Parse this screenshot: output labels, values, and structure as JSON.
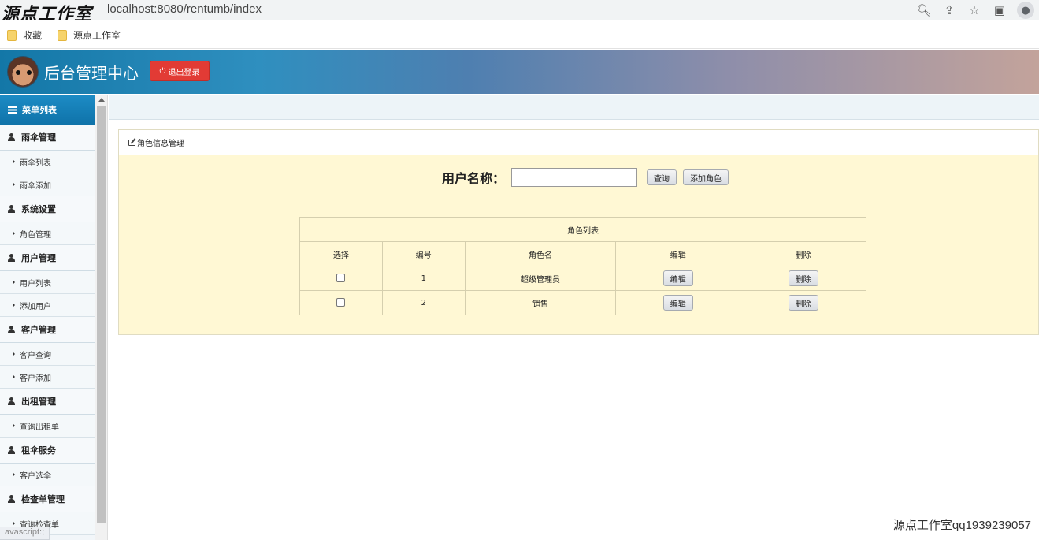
{
  "browser": {
    "url": "localhost:8080/rentumb/index",
    "watermark_top": "源点工作室",
    "bookmarks": [
      "收藏",
      "源点工作室"
    ],
    "status_text": "avascript:;"
  },
  "header": {
    "title": "后台管理中心",
    "logout_label": "退出登录"
  },
  "sidebar": {
    "title": "菜单列表",
    "groups": [
      {
        "label": "雨伞管理",
        "items": [
          "雨伞列表",
          "雨伞添加"
        ]
      },
      {
        "label": "系统设置",
        "items": [
          "角色管理"
        ]
      },
      {
        "label": "用户管理",
        "items": [
          "用户列表",
          "添加用户"
        ]
      },
      {
        "label": "客户管理",
        "items": [
          "客户查询",
          "客户添加"
        ]
      },
      {
        "label": "出租管理",
        "items": [
          "查询出租单"
        ]
      },
      {
        "label": "租伞服务",
        "items": [
          "客户选伞"
        ]
      },
      {
        "label": "检查单管理",
        "items": [
          "查询检查单"
        ]
      }
    ]
  },
  "panel": {
    "title": "角色信息管理",
    "search_label": "用户名称：",
    "search_value": "",
    "query_label": "查询",
    "add_label": "添加角色",
    "table": {
      "caption": "角色列表",
      "headers": [
        "选择",
        "编号",
        "角色名",
        "编辑",
        "删除"
      ],
      "rows": [
        {
          "id": "1",
          "name": "超级管理员",
          "edit": "编辑",
          "delete": "删除"
        },
        {
          "id": "2",
          "name": "销售",
          "edit": "编辑",
          "delete": "删除"
        }
      ]
    }
  },
  "watermark_bottom": "源点工作室qq1939239057",
  "colors": {
    "header_start": "#1377a7",
    "header_end": "#c3a39b",
    "logout": "#e23b35",
    "panel_bg": "#fff8d4",
    "menu_head": "#1d8cc6"
  }
}
